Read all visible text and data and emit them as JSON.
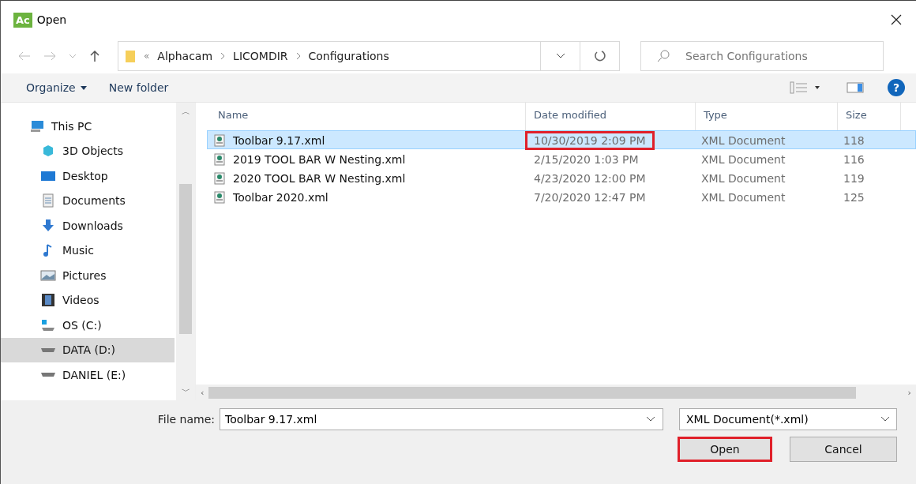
{
  "window": {
    "title": "Open",
    "app_badge": "Ac"
  },
  "address": {
    "overflow": "«",
    "crumbs": [
      "Alphacam",
      "LICOMDIR",
      "Configurations"
    ]
  },
  "search": {
    "placeholder": "Search Configurations"
  },
  "scroll_arrows": {
    "up": "︿",
    "down": "﹀",
    "left": "‹",
    "right": "›"
  },
  "toolbar": {
    "organize": "Organize",
    "new_folder": "New folder",
    "help": "?"
  },
  "sidebar": {
    "items": [
      {
        "label": "This PC",
        "kind": "pc",
        "selected": false
      },
      {
        "label": "3D Objects",
        "kind": "cube",
        "selected": false
      },
      {
        "label": "Desktop",
        "kind": "desktop",
        "selected": false
      },
      {
        "label": "Documents",
        "kind": "doc",
        "selected": false
      },
      {
        "label": "Downloads",
        "kind": "download",
        "selected": false
      },
      {
        "label": "Music",
        "kind": "music",
        "selected": false
      },
      {
        "label": "Pictures",
        "kind": "picture",
        "selected": false
      },
      {
        "label": "Videos",
        "kind": "video",
        "selected": false
      },
      {
        "label": "OS (C:)",
        "kind": "osdrive",
        "selected": false
      },
      {
        "label": "DATA (D:)",
        "kind": "drive",
        "selected": true
      },
      {
        "label": "DANIEL (E:)",
        "kind": "drive",
        "selected": false
      }
    ]
  },
  "table": {
    "columns": [
      "Name",
      "Date modified",
      "Type",
      "Size"
    ],
    "rows": [
      {
        "name": "Toolbar 9.17.xml",
        "date": "10/30/2019 2:09 PM",
        "type": "XML Document",
        "size": "118",
        "selected": true,
        "date_highlighted": true
      },
      {
        "name": "2019 TOOL BAR W Nesting.xml",
        "date": "2/15/2020 1:03 PM",
        "type": "XML Document",
        "size": "116",
        "selected": false,
        "date_highlighted": false
      },
      {
        "name": "2020 TOOL BAR W Nesting.xml",
        "date": "4/23/2020 12:00 PM",
        "type": "XML Document",
        "size": "119",
        "selected": false,
        "date_highlighted": false
      },
      {
        "name": "Toolbar 2020.xml",
        "date": "7/20/2020 12:47 PM",
        "type": "XML Document",
        "size": "125",
        "selected": false,
        "date_highlighted": false
      }
    ]
  },
  "footer": {
    "file_name_label": "File name:",
    "file_name_value": "Toolbar 9.17.xml",
    "file_type": "XML Document(*.xml)",
    "buttons": [
      {
        "label": "Open",
        "highlighted": true
      },
      {
        "label": "Cancel",
        "highlighted": false
      }
    ]
  }
}
